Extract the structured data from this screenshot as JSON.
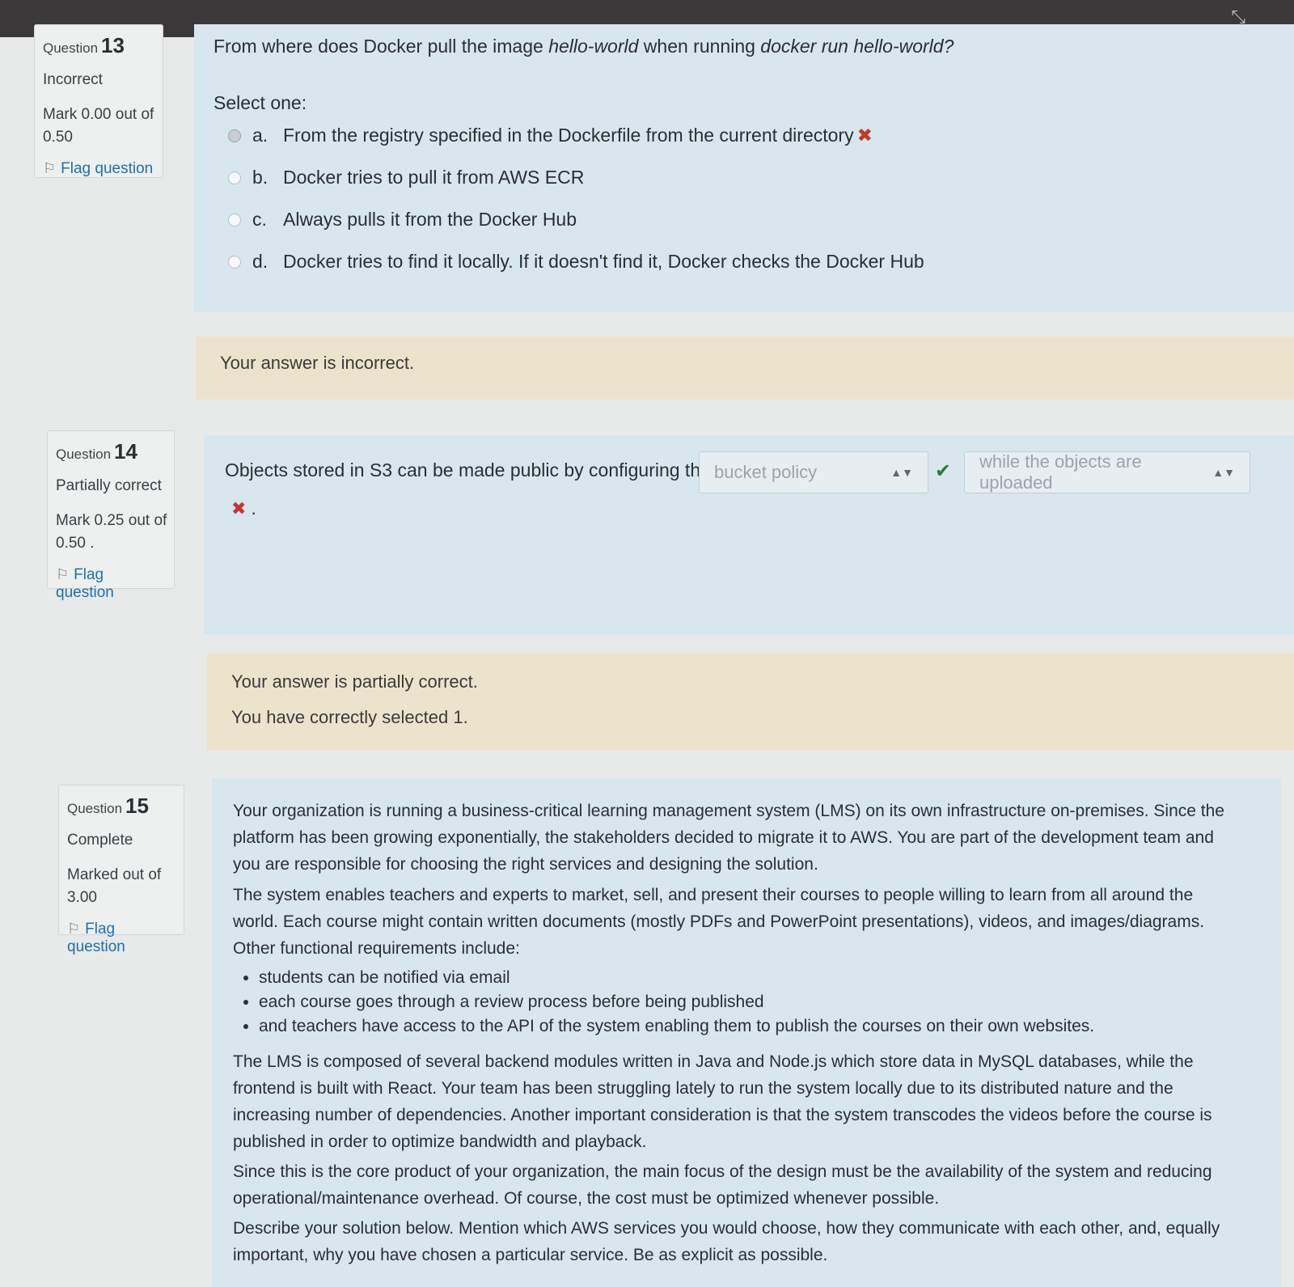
{
  "q13": {
    "label": "Question",
    "number": "13",
    "state": "Incorrect",
    "mark": "Mark 0.00 out of 0.50",
    "flag": "Flag question",
    "text_start": "From where does Docker pull the image ",
    "text_em1": "hello-world",
    "text_mid": " when running ",
    "text_em2": "docker run hello-world?",
    "prompt": "Select one:",
    "options": [
      {
        "letter": "a.",
        "text": "From the registry specified in the Dockerfile from the current directory"
      },
      {
        "letter": "b.",
        "text": "Docker tries to pull it from AWS ECR"
      },
      {
        "letter": "c.",
        "text": "Always pulls it from the Docker Hub"
      },
      {
        "letter": "d.",
        "text": "Docker tries to find it locally. If it doesn't find it, Docker checks the Docker Hub"
      }
    ],
    "feedback": "Your answer is incorrect."
  },
  "q14": {
    "label": "Question",
    "number": "14",
    "state": "Partially correct",
    "mark": "Mark 0.25 out of 0.50 .",
    "flag": "Flag question",
    "text": "Objects stored in S3 can be made public by configuring the",
    "select1": "bucket policy",
    "select2": "while the objects are uploaded",
    "trailing": ".",
    "feedback1": "Your answer is partially correct.",
    "feedback2": "You have correctly selected 1."
  },
  "q15": {
    "label": "Question",
    "number": "15",
    "state": "Complete",
    "mark": "Marked out of 3.00",
    "flag": "Flag question",
    "p1": "Your organization is running a business-critical learning management system (LMS) on its own infrastructure on-premises. Since the platform has been growing exponentially, the stakeholders decided to migrate it to AWS. You are part of the development team and you are responsible for choosing the right services and designing the solution.",
    "p2": "The system enables teachers and experts to market, sell, and present their courses to people willing to learn from all around the world. Each course might contain written documents (mostly PDFs and PowerPoint presentations), videos, and images/diagrams. Other functional requirements include:",
    "bullets": [
      "students can be notified via email",
      "each course goes through a review process before being published",
      "and teachers have access to the API of the system enabling them to publish the courses on their own websites."
    ],
    "p3": "The LMS is composed of several backend modules written in Java and Node.js which store data in MySQL databases, while the frontend is built with React. Your team has been struggling lately to run the system locally due to its distributed nature and the increasing number of dependencies. Another important consideration is that the system transcodes the videos before the course is published in order to optimize bandwidth and playback.",
    "p4": "Since this is the core product of your organization, the main focus of the design must be the availability of the system and reducing operational/maintenance overhead. Of course, the cost must be optimized whenever possible.",
    "p5": "Describe your solution below. Mention which AWS services you would choose, how they communicate with each other, and, equally important, why you have chosen a particular service. Be as explicit as possible."
  },
  "icons": {
    "flag": "flag-icon",
    "incorrect": "cross-icon",
    "correct": "check-icon"
  },
  "colors": {
    "content_bg": "#d8e6ee",
    "feedback_bg": "#ece3cd",
    "link": "#1f6fb0",
    "incorrect": "#c0392b",
    "correct": "#2c7a3a"
  }
}
